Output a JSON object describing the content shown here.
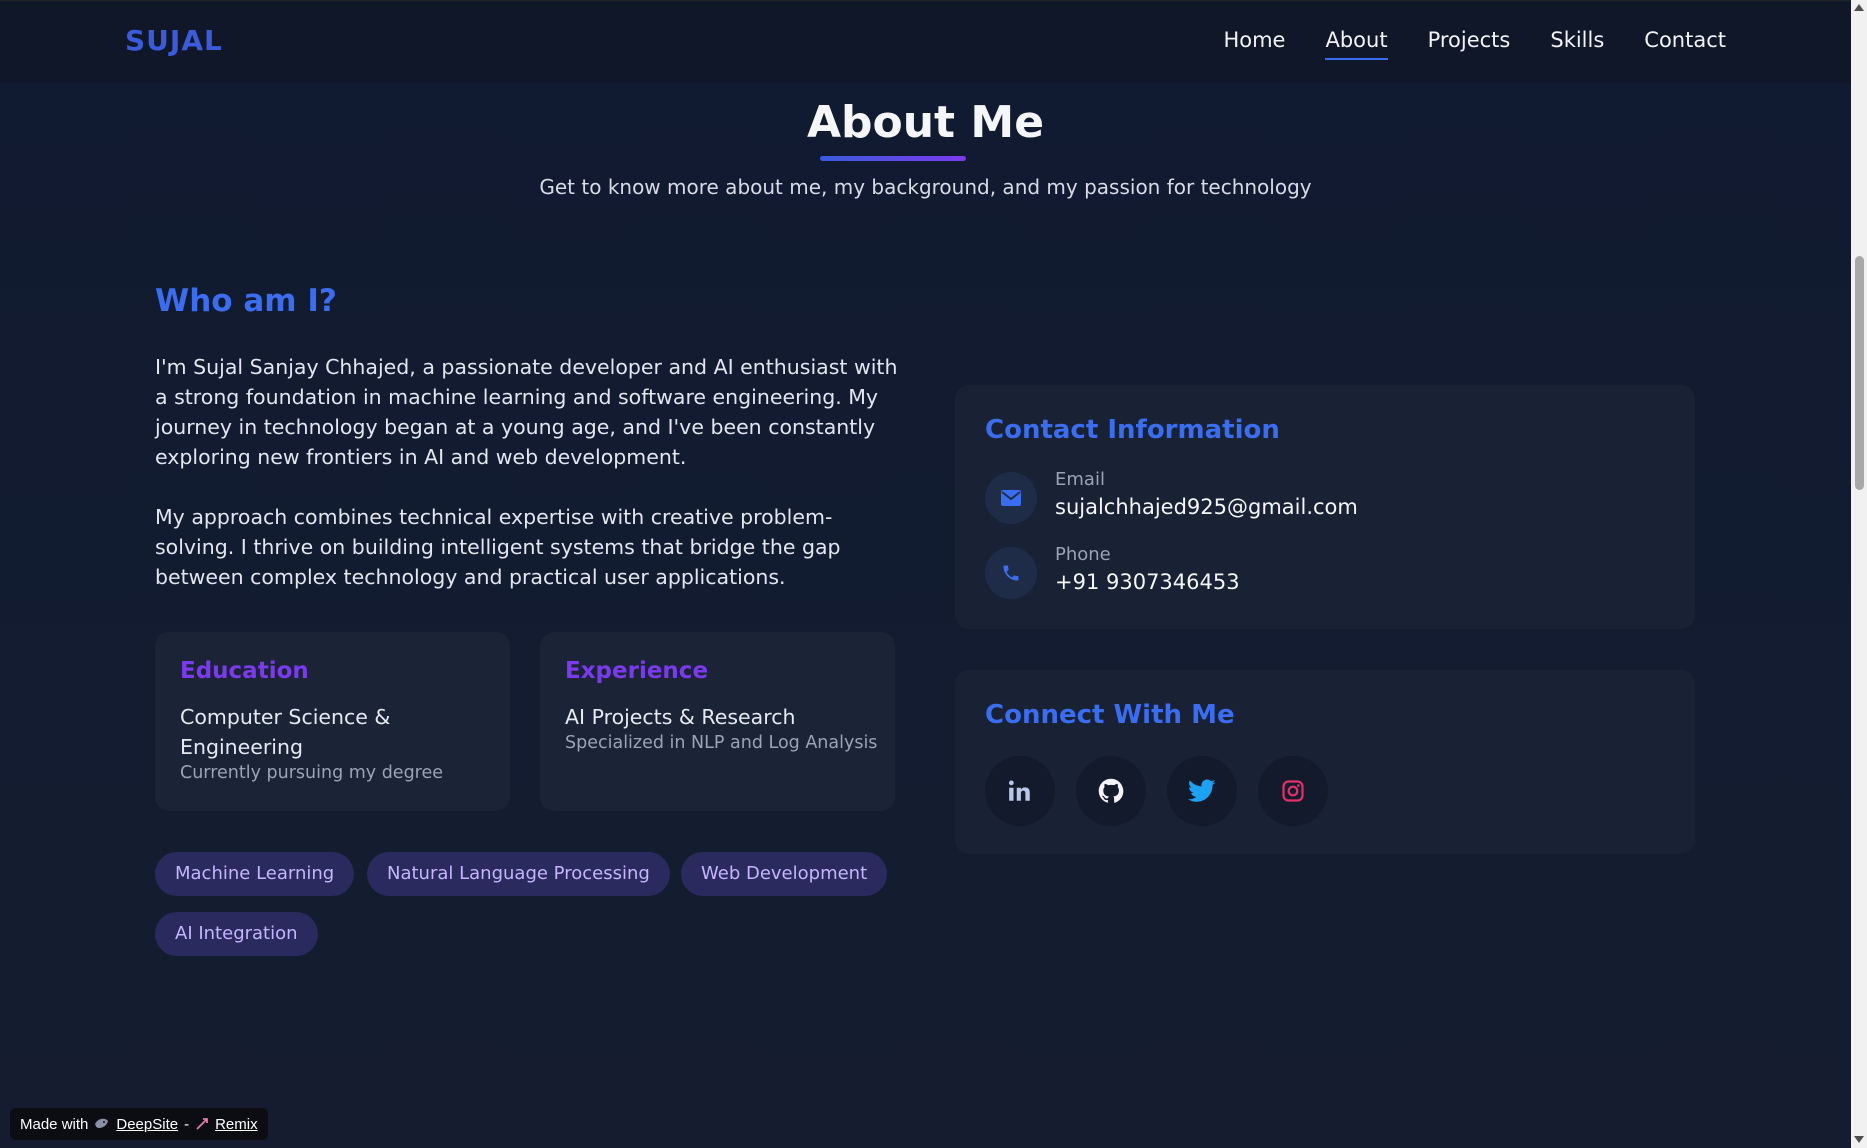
{
  "nav": {
    "logo": "SUJAL",
    "links": [
      "Home",
      "About",
      "Projects",
      "Skills",
      "Contact"
    ],
    "active": "About"
  },
  "header": {
    "title": "About Me",
    "subtitle": "Get to know more about me, my background, and my passion for technology"
  },
  "who": {
    "title": "Who am I?",
    "paragraphs": [
      "I'm Sujal Sanjay Chhajed, a passionate developer and AI enthusiast with a strong foundation in machine learning and software engineering. My journey in technology began at a young age, and I've been constantly exploring new frontiers in AI and web development.",
      "My approach combines technical expertise with creative problem-solving. I thrive on building intelligent systems that bridge the gap between complex technology and practical user applications."
    ]
  },
  "education": {
    "title": "Education",
    "main": "Computer Science & Engineering",
    "sub": "Currently pursuing my degree"
  },
  "experience": {
    "title": "Experience",
    "main": "AI Projects & Research",
    "sub": "Specialized in NLP and Log Analysis"
  },
  "tags": [
    "Machine Learning",
    "Natural Language Processing",
    "Web Development",
    "AI Integration"
  ],
  "contact": {
    "title": "Contact Information",
    "email_label": "Email",
    "email_value": "sujalchhajed925@gmail.com",
    "phone_label": "Phone",
    "phone_value": "+91 9307346453"
  },
  "connect": {
    "title": "Connect With Me",
    "socials": [
      "linkedin-icon",
      "github-icon",
      "twitter-icon",
      "instagram-icon"
    ]
  },
  "badge": {
    "made_with": "Made with",
    "deepsite": "DeepSite",
    "separator": "-",
    "remix": "Remix"
  },
  "colors": {
    "accent_blue": "#3b6df0",
    "accent_purple": "#7c3aed",
    "instagram": "#e1306c",
    "twitter": "#1da1f2"
  }
}
